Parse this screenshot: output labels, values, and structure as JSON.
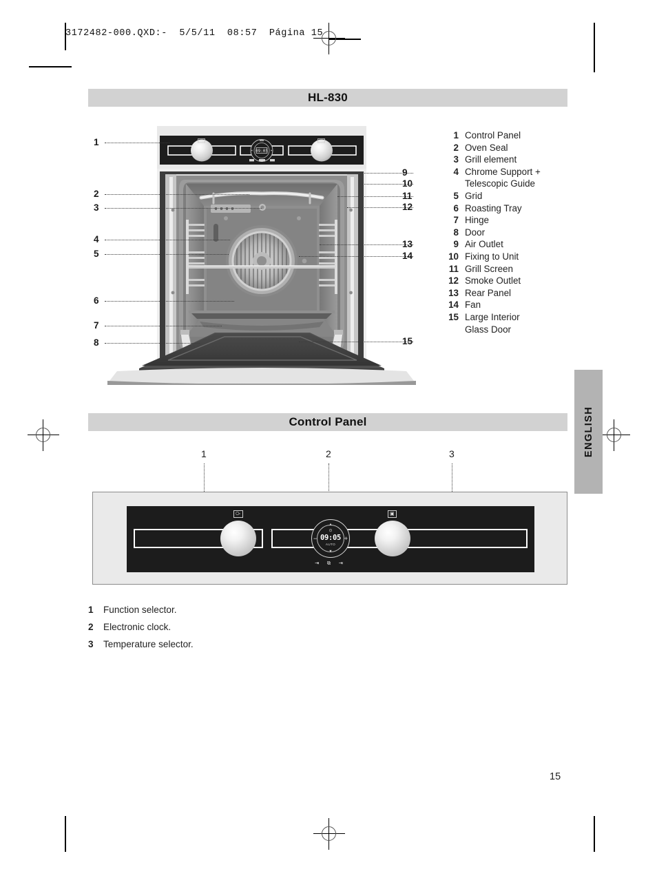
{
  "print_header": {
    "text": "3172482-000.QXD:-  5/5/11  08:57  Página 15"
  },
  "sections": {
    "model_title": "HL-830",
    "control_panel_title": "Control Panel"
  },
  "side_tab": {
    "language": "ENGLISH"
  },
  "parts_list": [
    {
      "num": "1",
      "label": "Control Panel"
    },
    {
      "num": "2",
      "label": "Oven Seal"
    },
    {
      "num": "3",
      "label": "Grill element"
    },
    {
      "num": "4",
      "label": "Chrome Support +",
      "label_cont": "Telescopic Guide"
    },
    {
      "num": "5",
      "label": "Grid"
    },
    {
      "num": "6",
      "label": "Roasting Tray"
    },
    {
      "num": "7",
      "label": "Hinge"
    },
    {
      "num": "8",
      "label": "Door"
    },
    {
      "num": "9",
      "label": "Air Outlet"
    },
    {
      "num": "10",
      "label": "Fixing to Unit"
    },
    {
      "num": "11",
      "label": "Grill Screen"
    },
    {
      "num": "12",
      "label": "Smoke Outlet"
    },
    {
      "num": "13",
      "label": "Rear Panel"
    },
    {
      "num": "14",
      "label": "Fan"
    },
    {
      "num": "15",
      "label": "Large Interior",
      "label_cont": "Glass Door"
    }
  ],
  "oven_callouts_left": [
    "1",
    "2",
    "3",
    "4",
    "5",
    "6",
    "7",
    "8"
  ],
  "oven_callouts_right": [
    "9",
    "10",
    "11",
    "12",
    "13",
    "14",
    "15"
  ],
  "control_panel_callouts": [
    "1",
    "2",
    "3"
  ],
  "control_panel_display": {
    "clock_time": "09:05",
    "clock_mode": "AUTO",
    "minus": "−",
    "plus": "+",
    "tick_top": "▲",
    "tick_bottom": "▼",
    "pot_icon": "⊙",
    "left_knob_icon": "⧉",
    "right_knob_icon": "▣",
    "buttons": "⇥ ⧉ ⇥"
  },
  "control_panel_legend": [
    {
      "num": "1",
      "label": "Function selector."
    },
    {
      "num": "2",
      "label": "Electronic clock."
    },
    {
      "num": "3",
      "label": "Temperature selector."
    }
  ],
  "page_number": "15",
  "colors": {
    "band_gray": "#d2d2d2",
    "tab_gray": "#b3b3b3",
    "panel_black": "#1c1c1c",
    "figure_bg": "#eaeaea"
  }
}
